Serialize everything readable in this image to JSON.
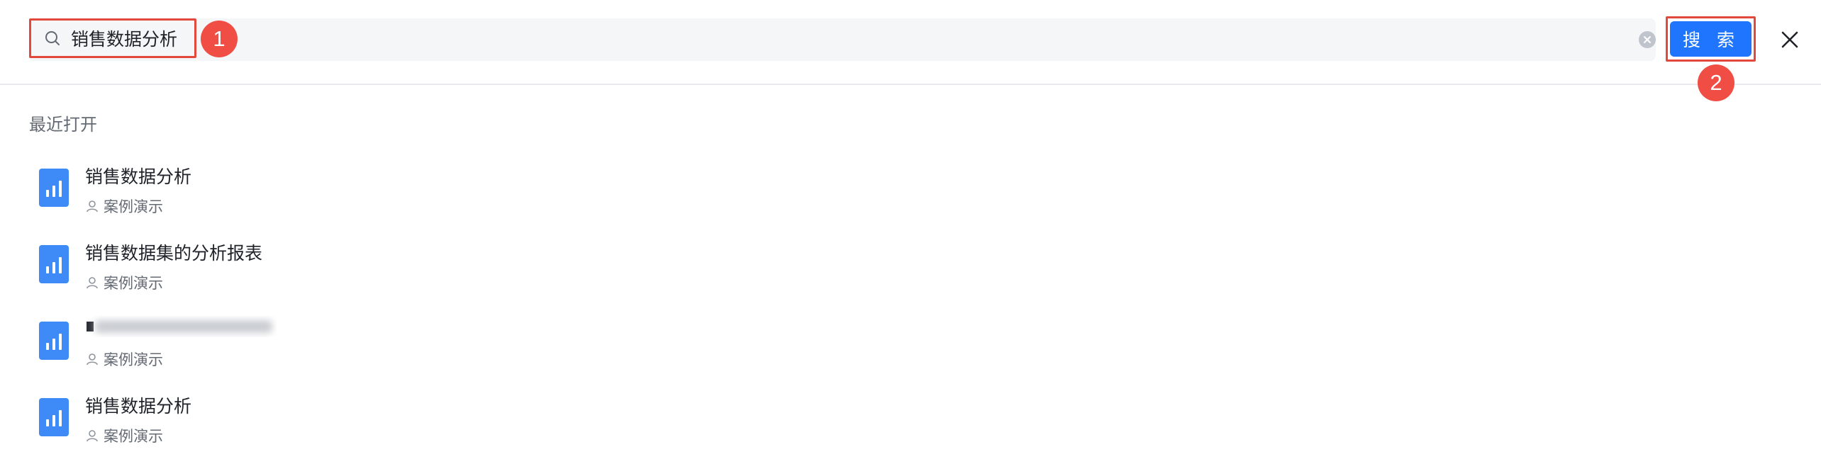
{
  "search": {
    "query": "销售数据分析",
    "button_label": "搜 索"
  },
  "annotations": {
    "step1": "1",
    "step2": "2"
  },
  "recent": {
    "title": "最近打开",
    "items": [
      {
        "title": "销售数据分析",
        "owner": "案例演示"
      },
      {
        "title": "销售数据集的分析报表",
        "owner": "案例演示"
      },
      {
        "title": "",
        "owner": "案例演示"
      },
      {
        "title": "销售数据分析",
        "owner": "案例演示"
      }
    ]
  },
  "icons": {
    "search": "search-icon",
    "clear": "clear-icon",
    "close": "close-icon",
    "file": "chart-file-icon",
    "person": "person-icon"
  },
  "colors": {
    "accent": "#1f75fe",
    "highlight": "#e2483c",
    "badge": "#f04e45"
  }
}
